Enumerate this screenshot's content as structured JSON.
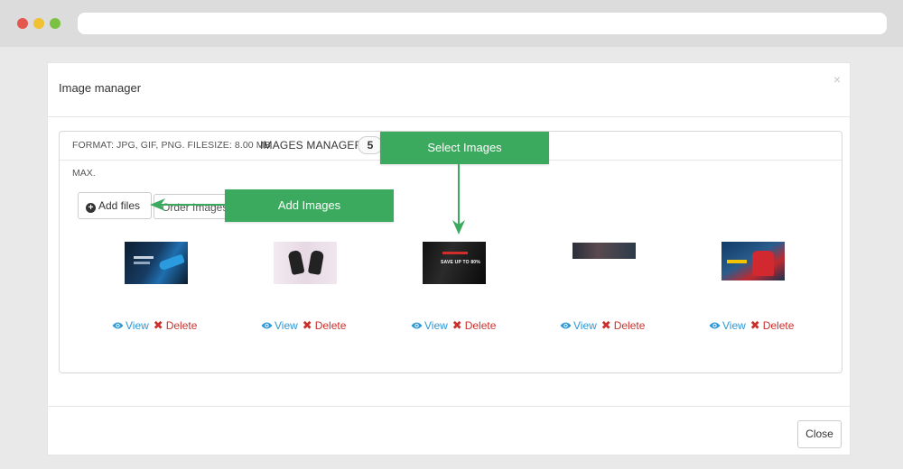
{
  "modal": {
    "title": "Image manager",
    "close_x": "×",
    "close_button": "Close"
  },
  "panel": {
    "format_line": "FORMAT: JPG, GIF, PNG. FILESIZE: 8.00 MB",
    "max_line": "MAX.",
    "section_label": "IMAGES MANAGER",
    "image_count": "5",
    "add_files_label": "Add files",
    "order_images_label": "Order Images"
  },
  "images": [
    {
      "view_label": "View",
      "delete_label": "Delete"
    },
    {
      "view_label": "View",
      "delete_label": "Delete"
    },
    {
      "view_label": "View",
      "delete_label": "Delete"
    },
    {
      "view_label": "View",
      "delete_label": "Delete"
    },
    {
      "view_label": "View",
      "delete_label": "Delete"
    }
  ],
  "thumbnails": {
    "promo_text": "SAVE UP TO 80%"
  },
  "callouts": {
    "select_images": "Select Images",
    "add_images": "Add Images",
    "color": "#3caa5e"
  },
  "colors": {
    "link": "#2a97d8",
    "danger": "#c9302c"
  },
  "icons": {
    "plus": "plus-circle-icon",
    "view": "eye-icon",
    "delete": "times-icon"
  }
}
